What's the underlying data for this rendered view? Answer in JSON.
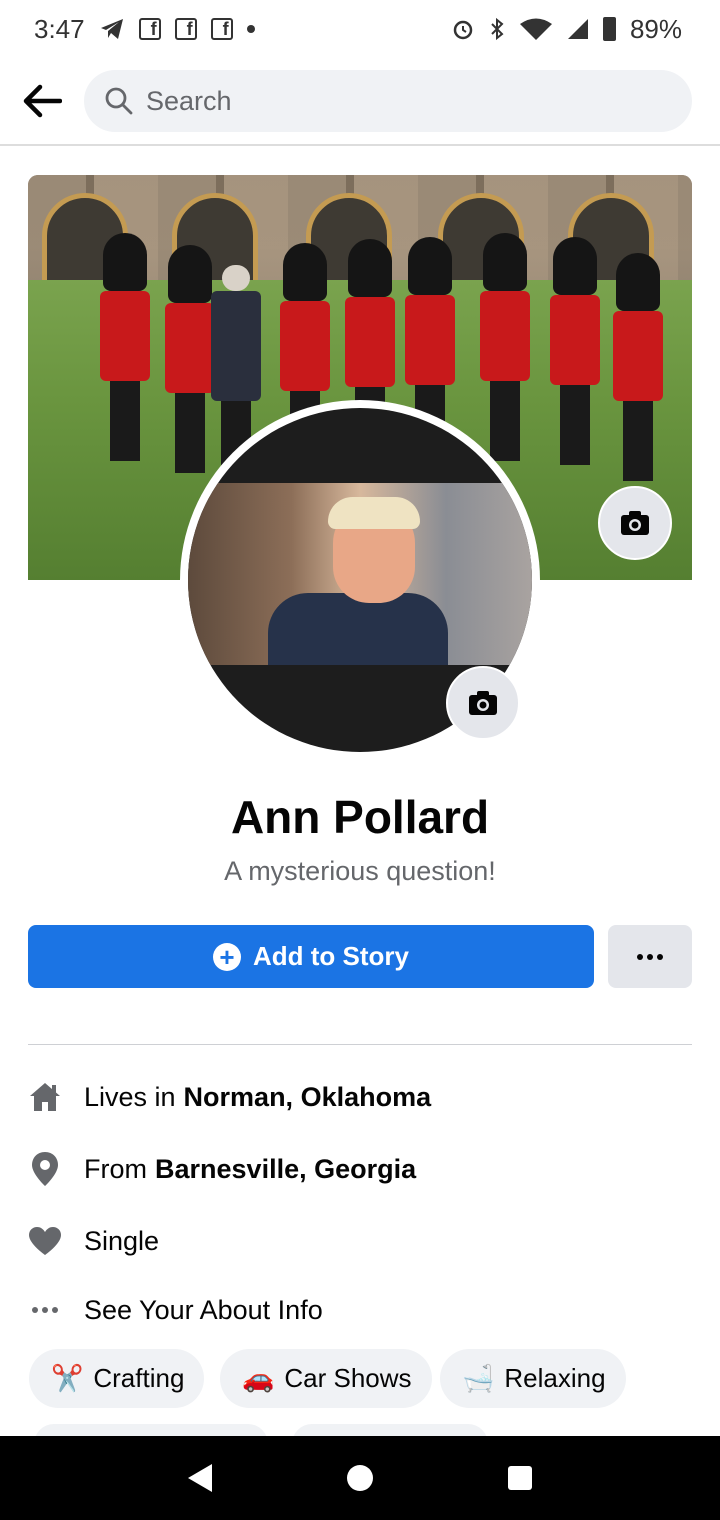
{
  "status_bar": {
    "time": "3:47",
    "battery": "89%",
    "icons": [
      "telegram-icon",
      "facebook-icon",
      "facebook-icon",
      "facebook-icon",
      "dot-icon",
      "alarm-icon",
      "bluetooth-icon",
      "wifi-icon",
      "signal-icon",
      "battery-icon"
    ]
  },
  "header": {
    "back_icon": "arrow-left-icon",
    "search_placeholder": "Search"
  },
  "profile": {
    "name": "Ann Pollard",
    "bio": "A mysterious question!"
  },
  "actions": {
    "add_story_label": "Add to Story"
  },
  "info": {
    "lives_prefix": "Lives in",
    "lives_place": "Norman, Oklahoma",
    "from_prefix": "From",
    "from_place": "Barnesville, Georgia",
    "relationship": "Single",
    "about_link": "See Your About Info"
  },
  "hobbies": [
    {
      "emoji": "✂️",
      "label": "Crafting"
    },
    {
      "emoji": "🚗",
      "label": "Car Shows"
    },
    {
      "emoji": "🛁",
      "label": "Relaxing"
    }
  ],
  "colors": {
    "accent": "#1b74e4",
    "chip_bg": "#f0f2f5",
    "secondary_text": "#65676b"
  }
}
